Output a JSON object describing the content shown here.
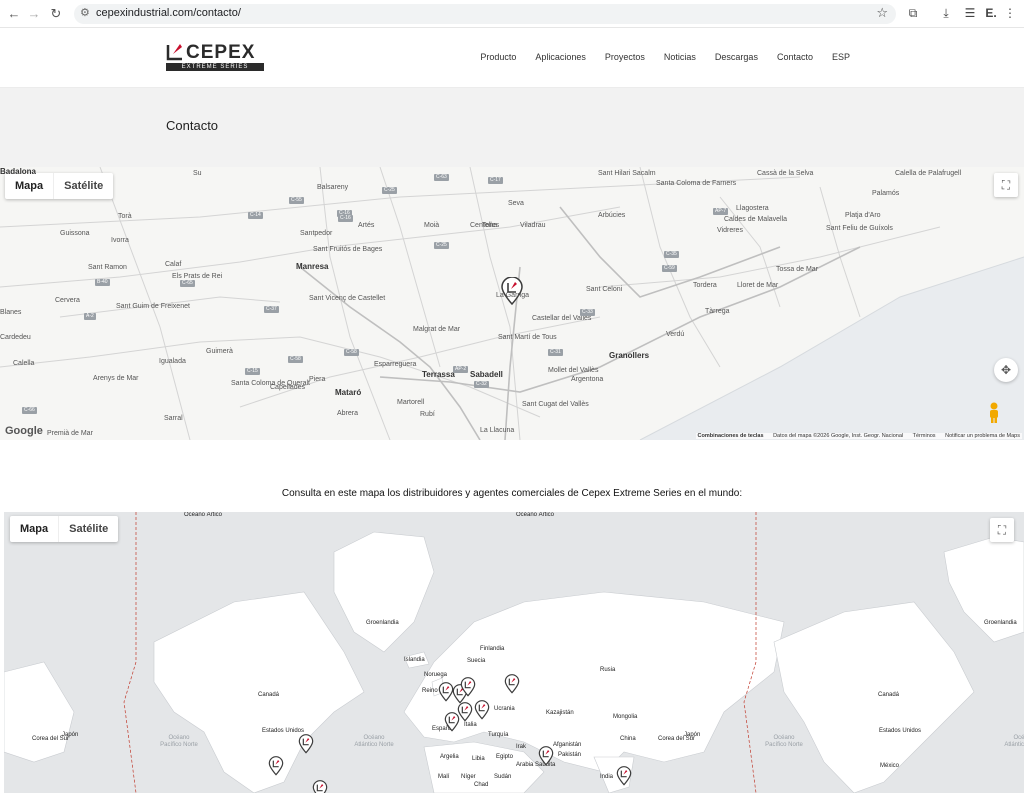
{
  "browser": {
    "url": "cepexindustrial.com/contacto/",
    "back": "←",
    "forward": "→",
    "reload": "↻",
    "tune": "⚙",
    "star": "☆",
    "extensions": "⧉",
    "download": "⤓",
    "profile": "E.",
    "more": "⋮"
  },
  "header": {
    "brand": "CEPEX",
    "tagline": "EXTREME SERIES",
    "menu": [
      "Producto",
      "Aplicaciones",
      "Proyectos",
      "Noticias",
      "Descargas",
      "Contacto",
      "ESP"
    ]
  },
  "page": {
    "title": "Contacto"
  },
  "map1": {
    "type_map": "Mapa",
    "type_satellite": "Satélite",
    "google": "Google",
    "attribution": {
      "shortcuts": "Combinaciones de teclas",
      "data": "Datos del mapa ©2026 Google, Inst. Geogr. Nacional",
      "terms": "Términos",
      "report": "Notificar un problema de Maps"
    },
    "places": [
      "Su",
      "Balsareny",
      "Artés",
      "Moià",
      "Tona",
      "Seva",
      "Viladrau",
      "Sant Hilari Sacalm",
      "Santa Coloma de Farners",
      "Cassà de la Selva",
      "Calella de Palafrugell",
      "Palamós",
      "Torà",
      "Guissona",
      "Ivorra",
      "Santpedor",
      "Sant Fruitós de Bages",
      "Centelles",
      "Arbúcies",
      "Caldes de Malavella",
      "Llagostera",
      "Platja d'Aro",
      "Vidreres",
      "Sant Feliu de Guíxols",
      "Calaf",
      "Els Prats de Rei",
      "Manresa",
      "Sant Ramon",
      "Tossa de Mar",
      "Cervera",
      "Sant Guim de Freixenet",
      "Sant Vicenç de Castellet",
      "La Garriga",
      "Sant Celoni",
      "Tordera",
      "Lloret de Mar",
      "Blanes",
      "Tàrrega",
      "Malgrat de Mar",
      "Castellar del Vallès",
      "Cardedeu",
      "Verdú",
      "Calella",
      "Guimerà",
      "Igualada",
      "Sant Martí de Tous",
      "Granollers",
      "Arenys de Mar",
      "Santa Coloma de Queralt",
      "Capellades",
      "Piera",
      "Esparreguera",
      "Terrassa",
      "Sabadell",
      "Mollet del Vallès",
      "Argentona",
      "Mataró",
      "Abrera",
      "Martorell",
      "Rubí",
      "Sant Cugat del Vallès",
      "Premià de Mar",
      "Sarral",
      "La Llacuna",
      "Badalona"
    ],
    "roads": [
      "C-55",
      "C-16",
      "C-25",
      "C-17",
      "C-37",
      "C-63",
      "C-35",
      "AP-7",
      "C-65",
      "C-14",
      "C-25",
      "C-59",
      "A-2",
      "C-58",
      "B-40",
      "C-33",
      "C-32",
      "C-31",
      "C-15",
      "C-66",
      "AP-2",
      "C-16",
      "C-58"
    ]
  },
  "caption": "Consulta en este mapa los distribuidores y agentes comerciales de Cepex Extreme Series en el mundo:",
  "map2": {
    "type_map": "Mapa",
    "type_satellite": "Satélite",
    "labels": [
      "Océano Ártico",
      "Océano Ártico",
      "Groenlandia",
      "Groenlandia",
      "Islandia",
      "Finlandia",
      "Suecia",
      "Noruega",
      "Rusia",
      "Canadá",
      "Canadá",
      "Reino Unido",
      "Ucrania",
      "Kazajistán",
      "Mongolia",
      "Estados Unidos",
      "Estados Unidos",
      "España",
      "Italia",
      "Turquía",
      "Corea del Sur",
      "Japón",
      "Corea del Sur",
      "Japón",
      "China",
      "Argelia",
      "Libia",
      "Egipto",
      "Irak",
      "Afganistán",
      "Pakistán",
      "Arabia Saudita",
      "México",
      "Malí",
      "Níger",
      "Chad",
      "Sudán",
      "India"
    ],
    "oceans": [
      "Océano Pacífico Norte",
      "Océano Atlántico Norte",
      "Océano Pacífico Norte",
      "Océano Atlántico Norte"
    ]
  },
  "colors": {
    "brand_red": "#c8102e",
    "brand_dark": "#2b2b2b",
    "pin_gray": "#3c3c3c"
  }
}
